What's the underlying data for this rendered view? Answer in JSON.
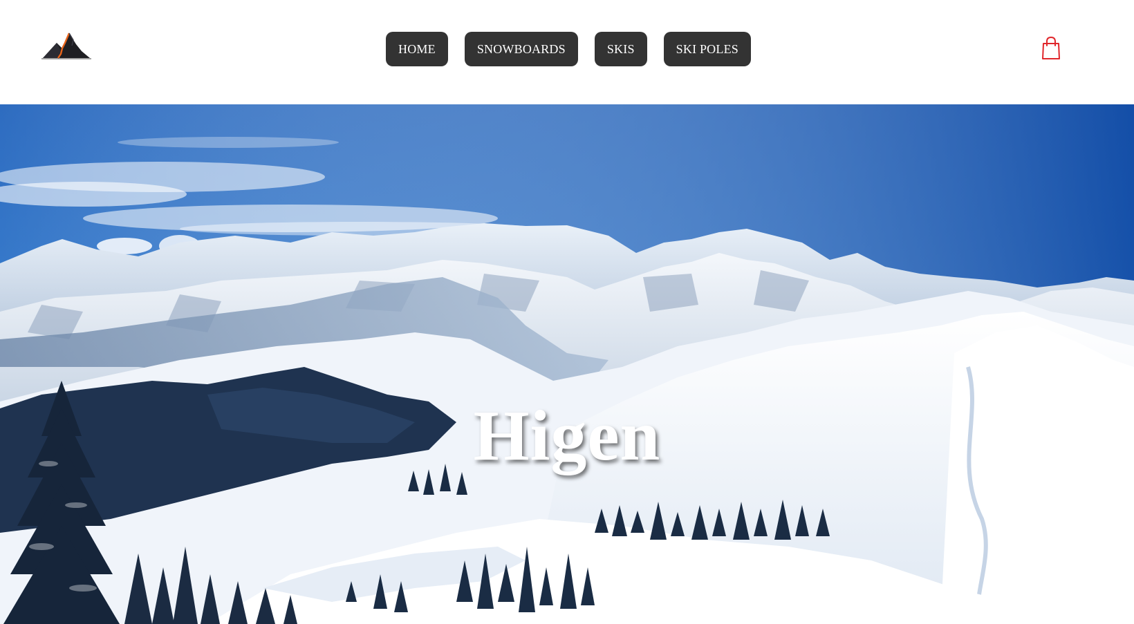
{
  "brand": {
    "logo_icon": "mountain-logo-icon"
  },
  "nav": {
    "items": [
      {
        "label": "HOME"
      },
      {
        "label": "SNOWBOARDS"
      },
      {
        "label": "SKIS"
      },
      {
        "label": "SKI POLES"
      }
    ]
  },
  "cart": {
    "icon": "shopping-bag-icon",
    "color": "#e0262b"
  },
  "hero": {
    "title": "Higen",
    "image": "snowy-mountain-landscape"
  },
  "colors": {
    "nav_button_bg": "#333333",
    "nav_button_text": "#ffffff",
    "sky_top": "#0d4aa0",
    "sky_bottom": "#3f86d4"
  }
}
